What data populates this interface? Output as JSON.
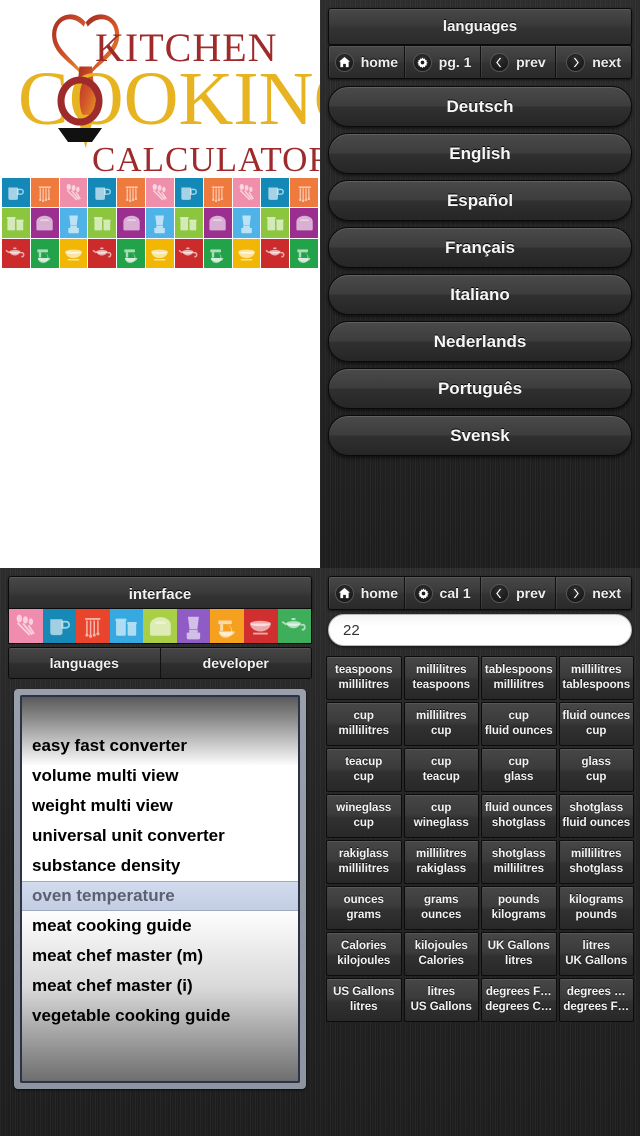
{
  "app": {
    "logo": {
      "line1": "KITCHEN",
      "line2": "COOKING",
      "line3": "CALCULATOR",
      "colors": {
        "dark_red": "#9e2a2b",
        "gold": "#e8b320",
        "orange": "#d4572a"
      }
    },
    "icon_grid_colors": [
      [
        "#1489b8",
        "#ef7a3e",
        "#ef8fab",
        "#1489b8",
        "#ef7a3e",
        "#ef8fab",
        "#1489b8",
        "#ef7a3e",
        "#ef8fab",
        "#1489b8",
        "#ef7a3e"
      ],
      [
        "#8cc63f",
        "#9b2f8f",
        "#4fb3e8",
        "#8cc63f",
        "#9b2f8f",
        "#4fb3e8",
        "#8cc63f",
        "#9b2f8f",
        "#4fb3e8",
        "#8cc63f",
        "#9b2f8f"
      ],
      [
        "#cc2b2b",
        "#22a34a",
        "#f2b705",
        "#cc2b2b",
        "#22a34a",
        "#f2b705",
        "#cc2b2b",
        "#22a34a",
        "#f2b705",
        "#cc2b2b",
        "#22a34a"
      ]
    ]
  },
  "languages_panel": {
    "title": "languages",
    "nav": [
      {
        "label": "home",
        "icon": "home-icon"
      },
      {
        "label": "pg. 1",
        "icon": "gear-icon"
      },
      {
        "label": "prev",
        "icon": "chevron-left-icon"
      },
      {
        "label": "next",
        "icon": "chevron-right-icon"
      }
    ],
    "items": [
      "Deutsch",
      "English",
      "Español",
      "Français",
      "Italiano",
      "Nederlands",
      "Português",
      "Svensk"
    ]
  },
  "interface_panel": {
    "title": "interface",
    "strip_colors": [
      "#f08cae",
      "#1689b6",
      "#e8452c",
      "#36a9e0",
      "#a8cf45",
      "#8e5cc4",
      "#f5a01e",
      "#d12f2f",
      "#3fae5a"
    ],
    "strip_icons": [
      "whisk-icon",
      "measuring-cup-icon",
      "utensils-icon",
      "canisters-icon",
      "toaster-icon",
      "blender-icon",
      "mixer-icon",
      "bowl-icon",
      "teapot-icon"
    ],
    "tabs": [
      {
        "label": "languages",
        "selected": true
      },
      {
        "label": "developer",
        "selected": false
      }
    ],
    "picker_items": [
      {
        "label": "easy fast converter",
        "selected": false
      },
      {
        "label": "volume multi view",
        "selected": false
      },
      {
        "label": "weight multi view",
        "selected": false
      },
      {
        "label": "universal unit converter",
        "selected": false
      },
      {
        "label": "substance density",
        "selected": false
      },
      {
        "label": "oven temperature",
        "selected": true
      },
      {
        "label": "meat cooking guide",
        "selected": false
      },
      {
        "label": "meat chef master (m)",
        "selected": false
      },
      {
        "label": "meat chef master (i)",
        "selected": false
      },
      {
        "label": "vegetable cooking guide",
        "selected": false
      }
    ]
  },
  "calculator_panel": {
    "nav": [
      {
        "label": "home",
        "icon": "home-icon"
      },
      {
        "label": "cal 1",
        "icon": "gear-icon"
      },
      {
        "label": "prev",
        "icon": "chevron-left-icon"
      },
      {
        "label": "next",
        "icon": "chevron-right-icon"
      }
    ],
    "input_value": "22",
    "input_placeholder": "",
    "conversions": [
      {
        "from": "teaspoons",
        "to": "millilitres"
      },
      {
        "from": "millilitres",
        "to": "teaspoons"
      },
      {
        "from": "tablespoons",
        "to": "millilitres"
      },
      {
        "from": "millilitres",
        "to": "tablespoons"
      },
      {
        "from": "cup",
        "to": "millilitres"
      },
      {
        "from": "millilitres",
        "to": "cup"
      },
      {
        "from": "cup",
        "to": "fluid ounces"
      },
      {
        "from": "fluid ounces",
        "to": "cup"
      },
      {
        "from": "teacup",
        "to": "cup"
      },
      {
        "from": "cup",
        "to": "teacup"
      },
      {
        "from": "cup",
        "to": "glass"
      },
      {
        "from": "glass",
        "to": "cup"
      },
      {
        "from": "wineglass",
        "to": "cup"
      },
      {
        "from": "cup",
        "to": "wineglass"
      },
      {
        "from": "fluid ounces",
        "to": "shotglass"
      },
      {
        "from": "shotglass",
        "to": "fluid ounces"
      },
      {
        "from": "rakiglass",
        "to": "millilitres"
      },
      {
        "from": "millilitres",
        "to": "rakiglass"
      },
      {
        "from": "shotglass",
        "to": "millilitres"
      },
      {
        "from": "millilitres",
        "to": "shotglass"
      },
      {
        "from": "ounces",
        "to": "grams"
      },
      {
        "from": "grams",
        "to": "ounces"
      },
      {
        "from": "pounds",
        "to": "kilograms"
      },
      {
        "from": "kilograms",
        "to": "pounds"
      },
      {
        "from": "Calories",
        "to": "kilojoules"
      },
      {
        "from": "kilojoules",
        "to": "Calories"
      },
      {
        "from": "UK Gallons",
        "to": "litres"
      },
      {
        "from": "litres",
        "to": "UK Gallons"
      },
      {
        "from": "US Gallons",
        "to": "litres"
      },
      {
        "from": "litres",
        "to": "US Gallons"
      },
      {
        "from": "degrees F…",
        "to": "degrees C…"
      },
      {
        "from": "degrees …",
        "to": "degrees F…"
      }
    ]
  }
}
